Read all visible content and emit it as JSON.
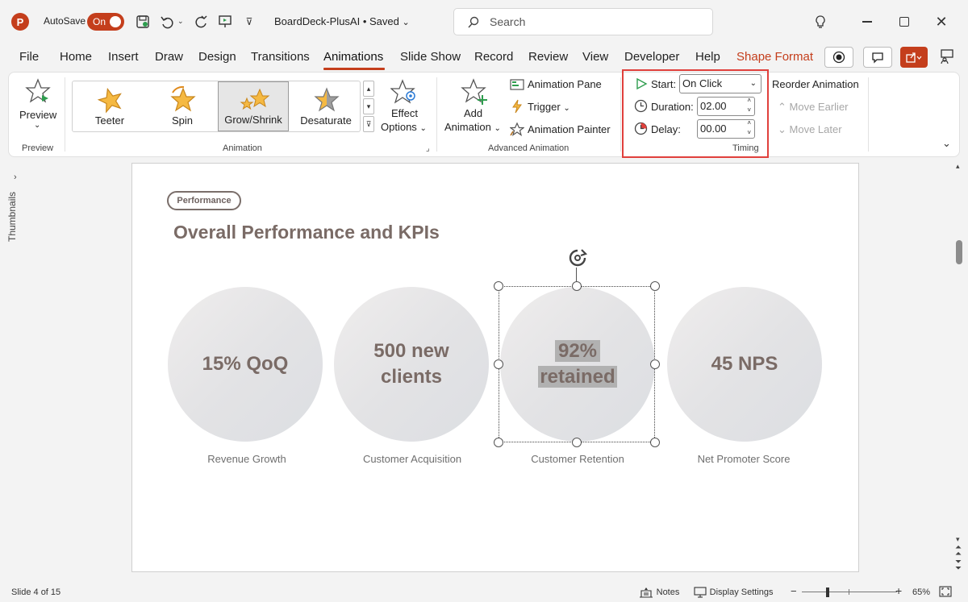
{
  "app": {
    "logo_letter": "P",
    "autosave_label": "AutoSave",
    "autosave_state": "On",
    "doc_title": "BoardDeck-PlusAI • Saved"
  },
  "search": {
    "placeholder": "Search"
  },
  "tabs": [
    "File",
    "Home",
    "Insert",
    "Draw",
    "Design",
    "Transitions",
    "Animations",
    "Slide Show",
    "Record",
    "Review",
    "View",
    "Developer",
    "Help",
    "Shape Format"
  ],
  "active_tab": "Animations",
  "ribbon": {
    "preview": {
      "label": "Preview",
      "group": "Preview"
    },
    "animation_gallery": {
      "items": [
        "Teeter",
        "Spin",
        "Grow/Shrink",
        "Desaturate"
      ],
      "selected": "Grow/Shrink",
      "group": "Animation"
    },
    "effect_options": {
      "line1": "Effect",
      "line2": "Options"
    },
    "advanced": {
      "add_line1": "Add",
      "add_line2": "Animation",
      "pane": "Animation Pane",
      "trigger": "Trigger",
      "painter": "Animation Painter",
      "group": "Advanced Animation"
    },
    "timing": {
      "start_label": "Start:",
      "start_value": "On Click",
      "duration_label": "Duration:",
      "duration_value": "02.00",
      "delay_label": "Delay:",
      "delay_value": "00.00",
      "group": "Timing"
    },
    "reorder": {
      "title": "Reorder Animation",
      "earlier": "Move Earlier",
      "later": "Move Later"
    }
  },
  "thumbnails_label": "Thumbnails",
  "slide": {
    "badge": "Performance",
    "title": "Overall Performance and KPIs",
    "kpis": [
      {
        "line1": "15% QoQ",
        "line2": "",
        "caption": "Revenue Growth"
      },
      {
        "line1": "500 new",
        "line2": "clients",
        "caption": "Customer Acquisition"
      },
      {
        "line1": "92%",
        "line2": "retained",
        "caption": "Customer Retention"
      },
      {
        "line1": "45 NPS",
        "line2": "",
        "caption": "Net Promoter Score"
      }
    ]
  },
  "status": {
    "slide_pos": "Slide 4 of 15",
    "notes": "Notes",
    "display": "Display Settings",
    "zoom": "65%"
  },
  "colors": {
    "accent": "#c43e1c",
    "highlight_box": "#e0403c",
    "kpi_text": "#7a6b66"
  }
}
